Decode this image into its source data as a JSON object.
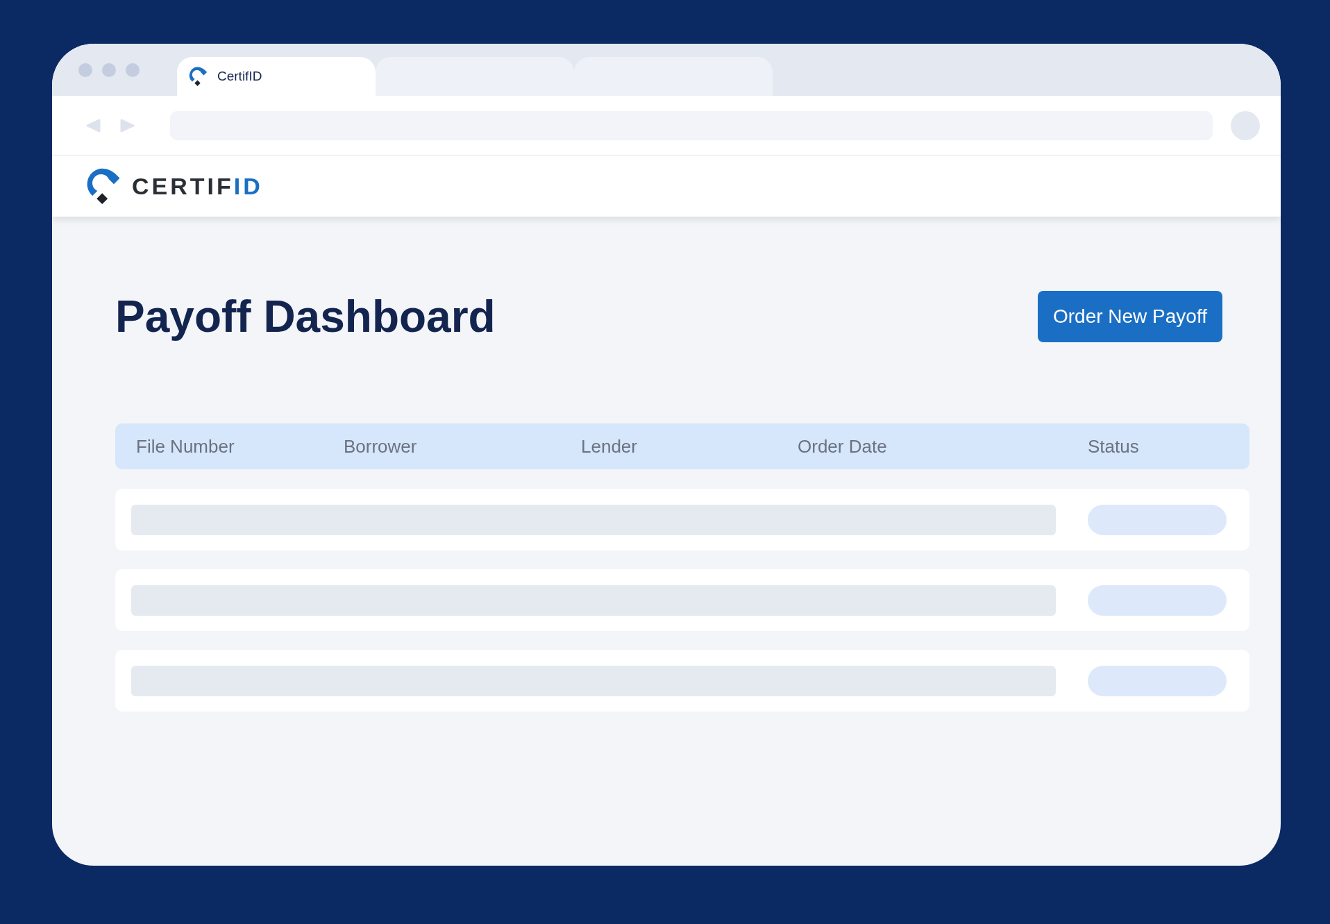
{
  "browser": {
    "tabs": [
      {
        "label": "CertifID",
        "selected": true
      },
      {
        "selected": false
      },
      {
        "selected": false
      }
    ]
  },
  "header": {
    "logo": {
      "text": "CERTIF",
      "accent": "ID"
    }
  },
  "page": {
    "title": "Payoff Dashboard",
    "action_button": "Order New Payoff"
  },
  "table": {
    "columns": [
      "File Number",
      "Borrower",
      "Lender",
      "Order Date",
      "Status"
    ],
    "rows": [
      {
        "kind": "skeleton"
      },
      {
        "kind": "skeleton"
      },
      {
        "kind": "skeleton"
      }
    ]
  }
}
